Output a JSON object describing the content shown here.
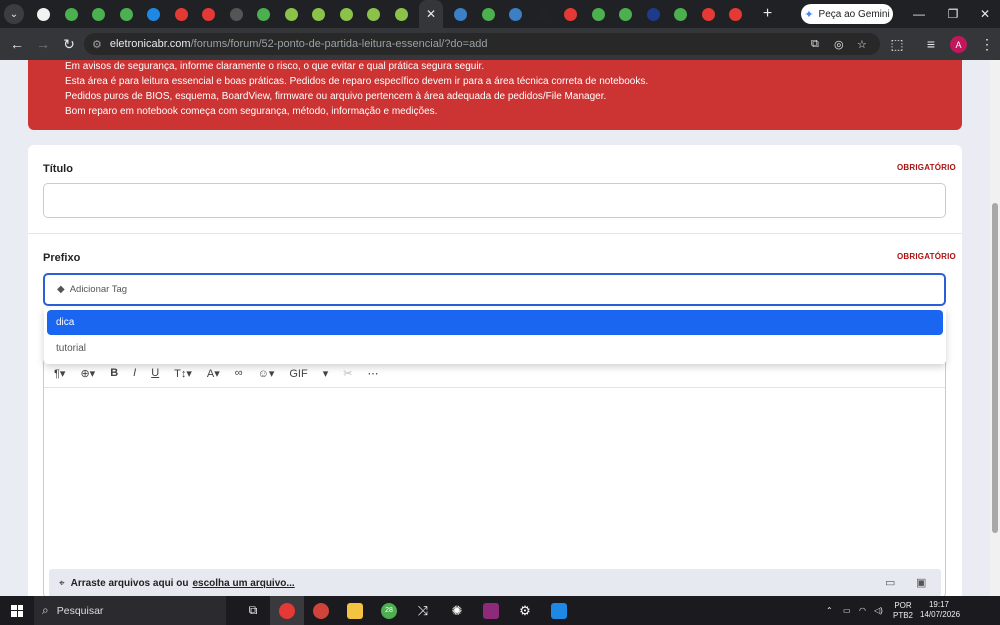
{
  "browser": {
    "gemini_label": "Peça ao Gemini",
    "url_host": "eletronicabr.com",
    "url_path": "/forums/forum/52-ponto-de-partida-leitura-essencial/?do=add",
    "profile_initial": "A",
    "active_tab_close": "✕",
    "new_tab": "+",
    "favicon_colors": [
      "#f2f2f2",
      "#4caf50",
      "#4caf50",
      "#4caf50",
      "#1e88e5",
      "#e53935",
      "#e53935",
      "#555555",
      "#4caf50",
      "#8bc34a",
      "#8bc34a",
      "#8bc34a",
      "#8bc34a",
      "#8bc34a",
      "#3d7fc4",
      "#4caf50",
      "#3d7fc4",
      "#222222",
      "#e53935",
      "#4caf50",
      "#4caf50",
      "#1e3a8a",
      "#4caf50",
      "#e53935",
      "#e53935"
    ]
  },
  "alert": {
    "lines": [
      "Em avisos de segurança, informe claramente o risco, o que evitar e qual prática segura seguir.",
      "Esta área é para leitura essencial e boas práticas. Pedidos de reparo específico devem ir para a área técnica correta de notebooks.",
      "Pedidos puros de BIOS, esquema, BoardView, firmware ou arquivo pertencem à área adequada de pedidos/File Manager.",
      "Bom reparo em notebook começa com segurança, método, informação e medições."
    ]
  },
  "form": {
    "title_label": "Título",
    "title_required": "OBRIGATÓRIO",
    "prefix_label": "Prefixo",
    "prefix_required": "OBRIGATÓRIO",
    "tag_placeholder": "Adicionar Tag",
    "options": [
      "dica",
      "tutorial"
    ],
    "editor_gif": "GIF",
    "attach_text": "Arraste arquivos aqui ou",
    "attach_link": "escolha um arquivo..."
  },
  "taskbar": {
    "search_label": "Pesquisar",
    "lang_1": "POR",
    "lang_2": "PTB2",
    "time": "19:17",
    "date": "14/07/2026",
    "chrome_badge": "28"
  }
}
